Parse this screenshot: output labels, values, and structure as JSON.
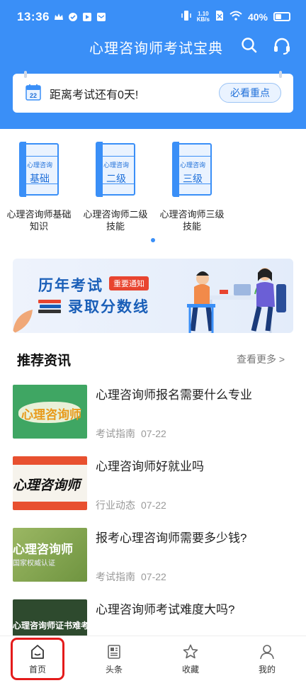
{
  "status_bar": {
    "time": "13:36",
    "net_speed_value": "1.10",
    "net_speed_unit": "KB/s",
    "battery": "40%"
  },
  "header": {
    "title": "心理咨询师考试宝典",
    "icons": [
      "search-icon",
      "headset-icon"
    ]
  },
  "notice": {
    "calendar_day": "22",
    "text": "距离考试还有0天!",
    "button": "必看重点"
  },
  "courses": [
    {
      "book_top": "心理咨询",
      "book_main": "基础",
      "name": "心理咨询师基础知识"
    },
    {
      "book_top": "心理咨询",
      "book_main": "二级",
      "name": "心理咨询师二级技能"
    },
    {
      "book_top": "心理咨询",
      "book_main": "三级",
      "name": "心理咨询师三级技能"
    }
  ],
  "banner": {
    "title_1": "历年考试",
    "badge": "重要通知",
    "title_2": "录取分数线"
  },
  "news_section": {
    "title": "推荐资讯",
    "more": "查看更多 >"
  },
  "news": [
    {
      "title": "心理咨询师报名需要什么专业",
      "category": "考试指南",
      "date": "07-22",
      "thumb_text": "心理咨询师"
    },
    {
      "title": "心理咨询师好就业吗",
      "category": "行业动态",
      "date": "07-22",
      "thumb_text": "心理咨询师"
    },
    {
      "title": "报考心理咨询师需要多少钱?",
      "category": "考试指南",
      "date": "07-22",
      "thumb_text": "心理咨询师",
      "thumb_subtext": "国家权威认证"
    },
    {
      "title": "心理咨询师考试难度大吗?",
      "category": "",
      "date": "",
      "thumb_text": "心理咨询师证书难考"
    }
  ],
  "bottom_nav": [
    {
      "label": "首页",
      "icon": "home-icon",
      "active": true
    },
    {
      "label": "头条",
      "icon": "news-icon",
      "active": false
    },
    {
      "label": "收藏",
      "icon": "star-icon",
      "active": false
    },
    {
      "label": "我的",
      "icon": "user-icon",
      "active": false
    }
  ],
  "colors": {
    "primary": "#3a8ff7",
    "highlight_border": "#e41b1b",
    "badge_red": "#e8442f"
  }
}
